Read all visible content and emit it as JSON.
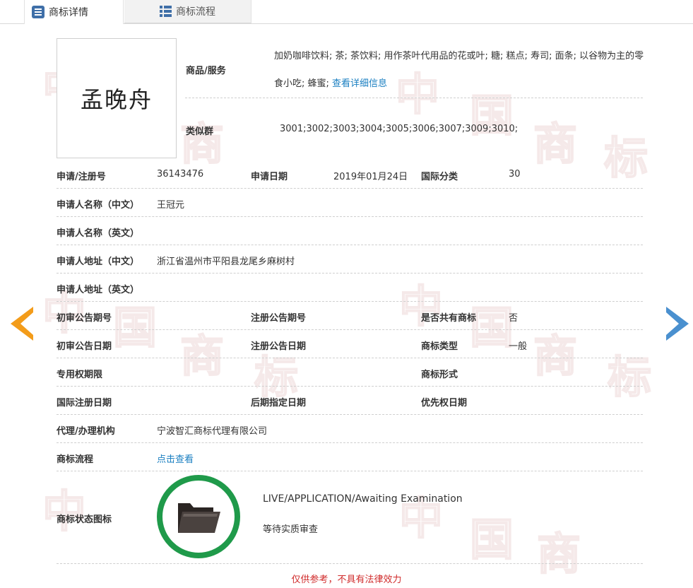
{
  "tabs": [
    {
      "label": "商标详情",
      "icon": "document-list-icon",
      "active": true
    },
    {
      "label": "商标流程",
      "icon": "list-icon",
      "active": false
    }
  ],
  "trademark": {
    "logo_text": "孟晚舟",
    "goods_label": "商品/服务",
    "goods_text": "加奶咖啡饮料; 茶; 茶饮料; 用作茶叶代用品的花或叶; 糖; 糕点; 寿司; 面条; 以谷物为主的零食小吃; 蜂蜜;",
    "goods_link": "查看详细信息",
    "similar_group_label": "类似群",
    "similar_group_value": "3001;3002;3003;3004;3005;3006;3007;3009;3010;"
  },
  "fields": {
    "reg_no_label": "申请/注册号",
    "reg_no_value": "36143476",
    "apply_date_label": "申请日期",
    "apply_date_value": "2019年01月24日",
    "intl_class_label": "国际分类",
    "intl_class_value": "30",
    "applicant_cn_label": "申请人名称（中文）",
    "applicant_cn_value": "王冠元",
    "applicant_en_label": "申请人名称（英文）",
    "address_cn_label": "申请人地址（中文）",
    "address_cn_value": "浙江省温州市平阳县龙尾乡麻树村",
    "address_en_label": "申请人地址（英文）",
    "prelim_pub_no_label": "初审公告期号",
    "reg_pub_no_label": "注册公告期号",
    "shared_label": "是否共有商标",
    "shared_value": "否",
    "prelim_pub_date_label": "初审公告日期",
    "reg_pub_date_label": "注册公告日期",
    "mark_type_label": "商标类型",
    "mark_type_value": "一般",
    "exclusive_period_label": "专用权期限",
    "mark_form_label": "商标形式",
    "intl_reg_date_label": "国际注册日期",
    "later_designation_label": "后期指定日期",
    "priority_date_label": "优先权日期",
    "agency_label": "代理/办理机构",
    "agency_value": "宁波智汇商标代理有限公司",
    "process_label": "商标流程",
    "process_link": "点击查看",
    "status_icon_label": "商标状态图标"
  },
  "status": {
    "icon": "folder-icon",
    "ring_color": "#1f9a4a",
    "english": "LIVE/APPLICATION/Awaiting Examination",
    "chinese": "等待实质审查"
  },
  "disclaimer": "仅供参考，不具有法律效力",
  "nav": {
    "prev_color": "#f39c1a",
    "next_color": "#4a90cf"
  },
  "watermark_chars": [
    "中",
    "国",
    "商",
    "标"
  ]
}
